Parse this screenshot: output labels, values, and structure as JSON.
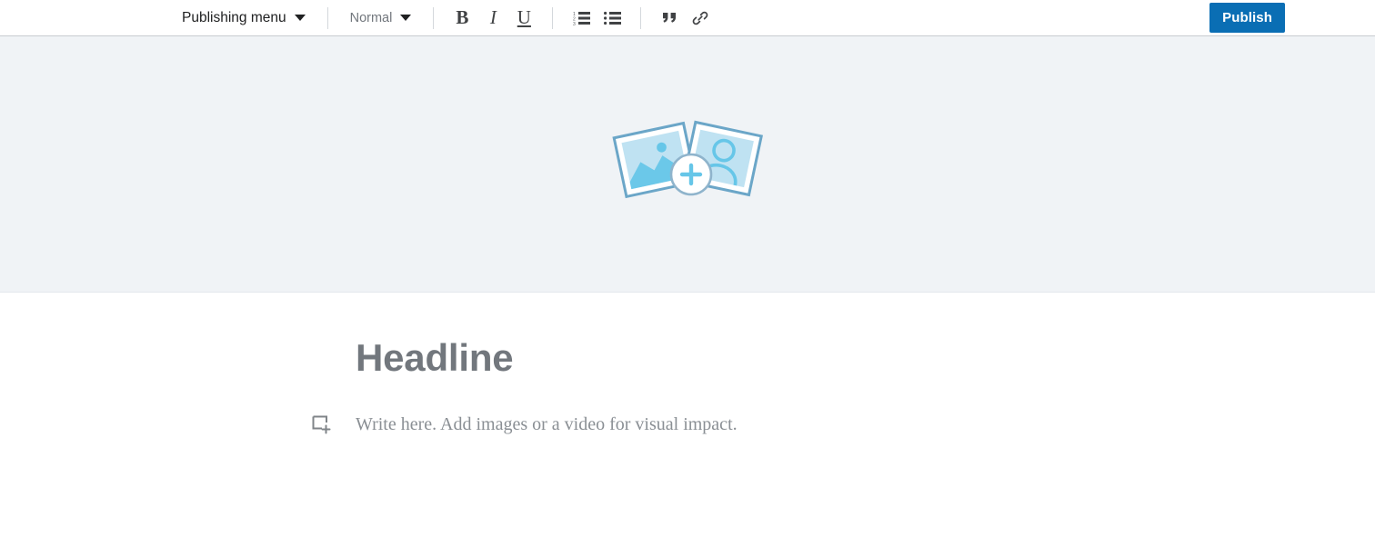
{
  "toolbar": {
    "publishing_menu": {
      "label": "Publishing menu",
      "icon": "chevron-down-icon"
    },
    "paragraph_style": {
      "label": "Normal",
      "icon": "chevron-down-icon"
    },
    "format_buttons": [
      {
        "name": "bold-button",
        "glyph": "B",
        "title": "Bold"
      },
      {
        "name": "italic-button",
        "glyph": "I",
        "title": "Italic"
      },
      {
        "name": "underline-button",
        "glyph": "U",
        "title": "Underline"
      }
    ],
    "list_buttons": [
      {
        "name": "ordered-list-button",
        "title": "Numbered list"
      },
      {
        "name": "unordered-list-button",
        "title": "Bulleted list"
      }
    ],
    "insert_buttons": [
      {
        "name": "blockquote-button",
        "glyph": "”",
        "title": "Quote"
      },
      {
        "name": "link-button",
        "title": "Link"
      }
    ],
    "publish_label": "Publish"
  },
  "hero": {
    "name": "lead-image-placeholder",
    "icon": "add-photos-icon",
    "alt": "Add a lead image"
  },
  "article": {
    "headline_placeholder": "Headline",
    "body_placeholder": "Write here. Add images or a video for visual impact.",
    "add_block_icon": "add-block-icon"
  },
  "colors": {
    "publish_blue": "#0a6eb4",
    "hero_background": "#f0f3f6",
    "placeholder_gray": "#72777d",
    "body_placeholder_gray": "#8a8f94",
    "icon_dark": "#404244",
    "photo_outline_blue": "#6ba6c8",
    "photo_fill_blue": "#bfe2f2",
    "plus_blue": "#66c6e8"
  }
}
